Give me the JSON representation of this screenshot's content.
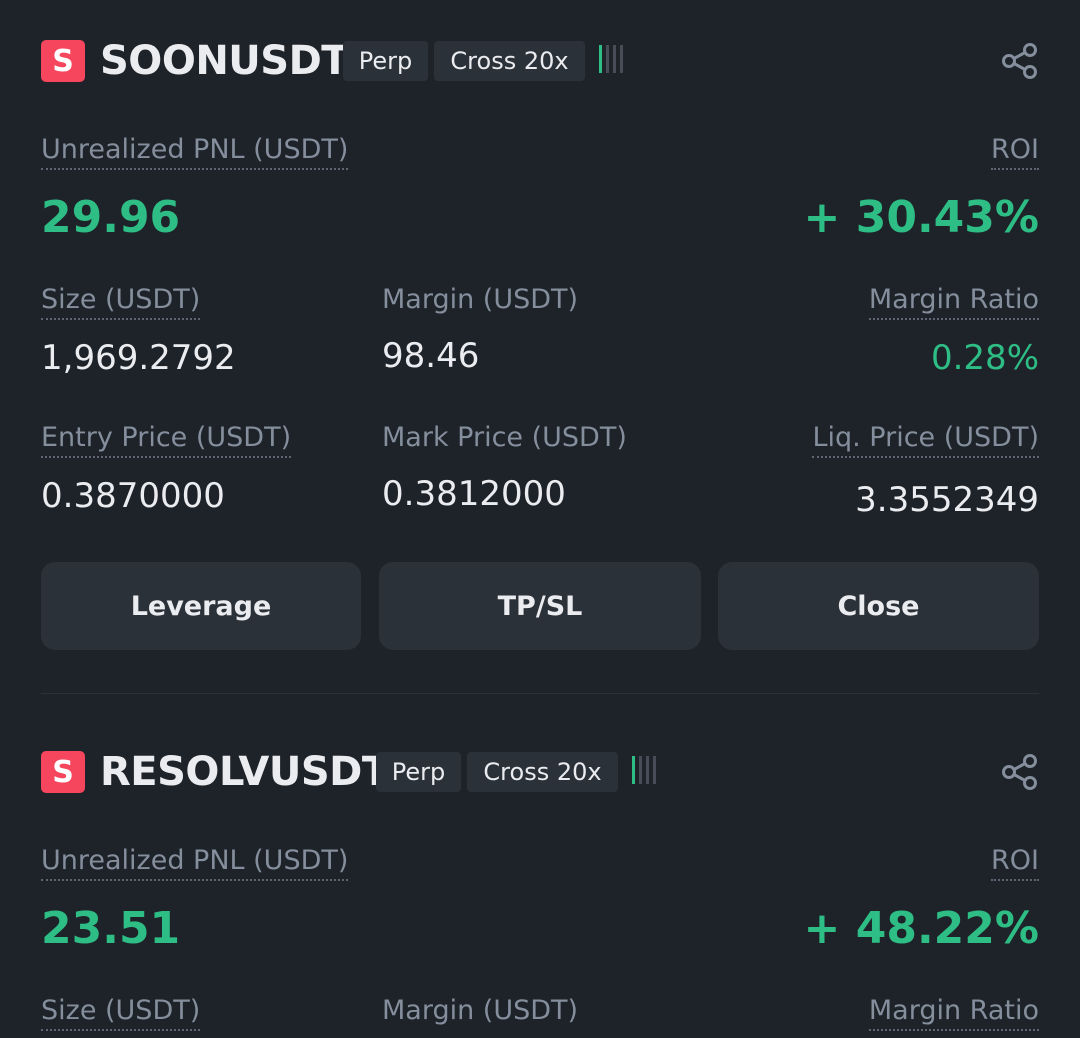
{
  "positions": [
    {
      "symbol_icon": "S",
      "symbol": "SOONUSDT",
      "type_tag": "Perp",
      "margin_tag": "Cross 20x",
      "risk_bars": "!!!!",
      "pnl_label": "Unrealized PNL (USDT)",
      "pnl_value": "29.96",
      "roi_label": "ROI",
      "roi_value": "+ 30.43%",
      "size_label": "Size (USDT)",
      "size_value": "1,969.2792",
      "margin_label": "Margin (USDT)",
      "margin_value": "98.46",
      "margin_ratio_label": "Margin Ratio",
      "margin_ratio_value": "0.28%",
      "entry_label": "Entry Price (USDT)",
      "entry_value": "0.3870000",
      "mark_label": "Mark Price (USDT)",
      "mark_value": "0.3812000",
      "liq_label": "Liq. Price (USDT)",
      "liq_value": "3.3552349",
      "buttons": {
        "leverage": "Leverage",
        "tpsl": "TP/SL",
        "close": "Close"
      }
    },
    {
      "symbol_icon": "S",
      "symbol": "RESOLVUSDT",
      "type_tag": "Perp",
      "margin_tag": "Cross 20x",
      "risk_bars": "!!!!",
      "pnl_label": "Unrealized PNL (USDT)",
      "pnl_value": "23.51",
      "roi_label": "ROI",
      "roi_value": "+ 48.22%",
      "size_label": "Size (USDT)",
      "margin_label": "Margin (USDT)",
      "margin_ratio_label": "Margin Ratio"
    }
  ],
  "colors": {
    "profit": "#2ebd85",
    "badge": "#f6465d",
    "background": "#1e2329",
    "button": "#2b3139"
  },
  "icons": {
    "share": "share-icon",
    "risk": "margin-risk-bars-icon"
  }
}
